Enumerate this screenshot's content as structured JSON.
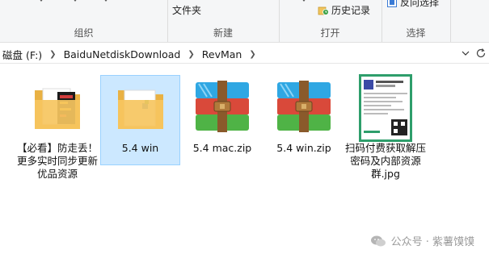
{
  "ribbon": {
    "groups": {
      "organize": "组织",
      "new": "新建",
      "open": "打开",
      "select": "选择"
    },
    "buttons": {
      "properties_menu": "文件夹",
      "history": "历史记录",
      "invert_selection": "反向选择"
    }
  },
  "address": {
    "crumbs": [
      "磁盘 (F:)",
      "BaiduNetdiskDownload",
      "RevMan"
    ]
  },
  "files": [
    {
      "name": "【必看】防走丢！更多实时同步更新优品资源",
      "type": "folder-with-docs"
    },
    {
      "name": "5.4 win",
      "type": "folder",
      "selected": true
    },
    {
      "name": "5.4 mac.zip",
      "type": "winrar-archive"
    },
    {
      "name": "5.4 win.zip",
      "type": "winrar-archive"
    },
    {
      "name": "扫码付费获取解压密码及内部资源群.jpg",
      "type": "image"
    }
  ],
  "watermark": {
    "label": "公众号 · 紫薯馍馍"
  },
  "colors": {
    "ribbon_bg": "#f5f6f7",
    "selection_bg": "#cce8ff",
    "selection_border": "#99d1ff",
    "folder_yellow": "#f6c560"
  }
}
